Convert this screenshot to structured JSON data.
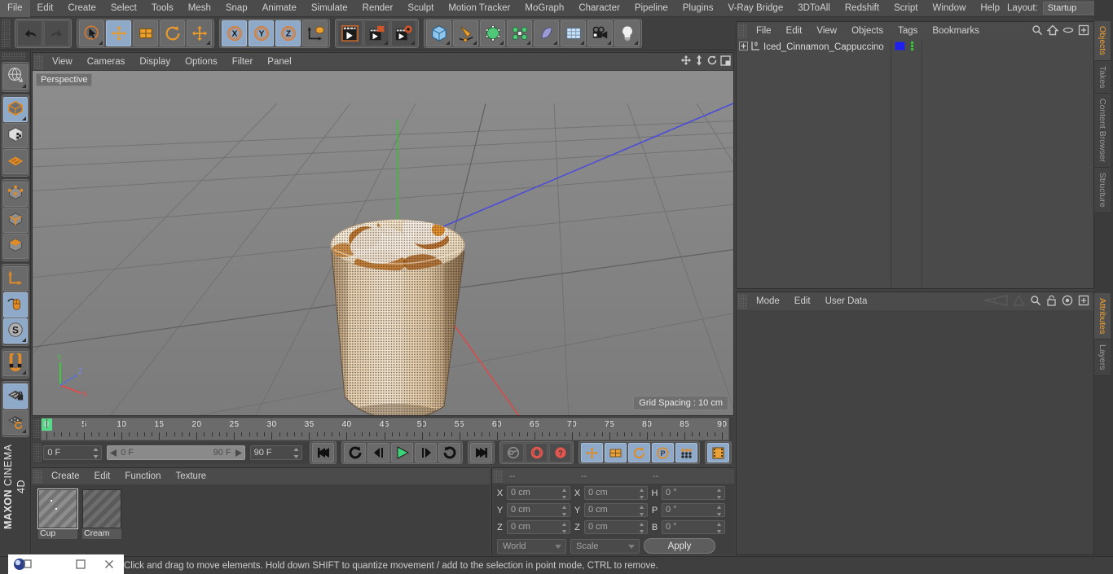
{
  "app": {
    "brand_line1": "MAXON",
    "brand_line2": "CINEMA 4D"
  },
  "menubar": {
    "items": [
      "File",
      "Edit",
      "Create",
      "Select",
      "Tools",
      "Mesh",
      "Snap",
      "Animate",
      "Simulate",
      "Render",
      "Sculpt",
      "Motion Tracker",
      "MoGraph",
      "Character",
      "Pipeline",
      "Plugins",
      "V-Ray Bridge",
      "3DToAll",
      "Redshift",
      "Script",
      "Window",
      "Help"
    ],
    "layout_label": "Layout:",
    "layout_value": "Startup",
    "search_icon": "search-icon"
  },
  "toolbar": {
    "groups": [
      {
        "name": "undo-redo",
        "buttons": [
          {
            "icon": "undo-icon",
            "label": "Undo",
            "active": false
          },
          {
            "icon": "redo-icon",
            "label": "Redo",
            "active": false
          }
        ]
      },
      {
        "name": "tools",
        "buttons": [
          {
            "icon": "live-selection-icon",
            "label": "Live Selection",
            "active": false
          },
          {
            "icon": "move-icon",
            "label": "Move",
            "active": true
          },
          {
            "icon": "scale-icon",
            "label": "Scale",
            "active": false
          },
          {
            "icon": "rotate-icon",
            "label": "Rotate",
            "active": false
          },
          {
            "icon": "move-alt-icon",
            "label": "Move Tool",
            "active": false
          }
        ]
      },
      {
        "name": "axis-locks",
        "buttons": [
          {
            "icon": "x-axis-icon",
            "label": "X",
            "active": true
          },
          {
            "icon": "y-axis-icon",
            "label": "Y",
            "active": true
          },
          {
            "icon": "z-axis-icon",
            "label": "Z",
            "active": true
          },
          {
            "icon": "world-object-axis-icon",
            "label": "World/Object",
            "active": false
          }
        ]
      },
      {
        "name": "render",
        "buttons": [
          {
            "icon": "render-view-icon",
            "label": "Render View",
            "active": false
          },
          {
            "icon": "render-region-icon",
            "label": "Render to Picture Viewer",
            "active": false
          },
          {
            "icon": "render-settings-icon",
            "label": "Render Settings",
            "active": false
          }
        ]
      },
      {
        "name": "creation",
        "buttons": [
          {
            "icon": "cube-primitive-icon",
            "label": "Cube",
            "active": false
          },
          {
            "icon": "spline-pen-icon",
            "label": "Pen",
            "active": false
          },
          {
            "icon": "generator-icon",
            "label": "Subdivision Surface",
            "active": false
          },
          {
            "icon": "deformer-icon",
            "label": "Bend Deformer",
            "active": false
          },
          {
            "icon": "scene-object-icon",
            "label": "Floor",
            "active": false
          },
          {
            "icon": "environment-icon",
            "label": "Environment",
            "active": false
          },
          {
            "icon": "camera-icon",
            "label": "Camera",
            "active": false
          },
          {
            "icon": "light-icon",
            "label": "Light",
            "active": false
          }
        ]
      }
    ]
  },
  "left_toolbar": {
    "groups": [
      {
        "name": "deform-group",
        "buttons": [
          {
            "icon": "make-editable-icon",
            "label": "Make Editable",
            "active": false
          }
        ]
      },
      {
        "name": "mode-group",
        "buttons": [
          {
            "icon": "model-mode-icon",
            "label": "Model Mode",
            "active": true
          },
          {
            "icon": "texture-mode-icon",
            "label": "Texture Mode",
            "active": false
          },
          {
            "icon": "workplane-mode-icon",
            "label": "Workplane Mode",
            "active": false
          }
        ]
      },
      {
        "name": "component-group",
        "buttons": [
          {
            "icon": "points-mode-icon",
            "label": "Points",
            "active": false
          },
          {
            "icon": "edges-mode-icon",
            "label": "Edges",
            "active": false
          },
          {
            "icon": "polygons-mode-icon",
            "label": "Polygons",
            "active": false
          }
        ]
      },
      {
        "name": "axis-group",
        "buttons": [
          {
            "icon": "enable-axis-icon",
            "label": "Enable Axis Modification",
            "active": false
          },
          {
            "icon": "viewport-solo-icon",
            "label": "Viewport Solo",
            "active": true
          },
          {
            "icon": "enable-snap-icon",
            "label": "Enable Snapping",
            "active": true
          }
        ]
      },
      {
        "name": "magnet-group",
        "buttons": [
          {
            "icon": "magnet-icon",
            "label": "Magnet",
            "active": false
          }
        ]
      },
      {
        "name": "workplane-group",
        "buttons": [
          {
            "icon": "lock-workplane-icon",
            "label": "Lock Workplane",
            "active": true
          },
          {
            "icon": "planar-workplane-icon",
            "label": "Planar Workplane",
            "active": false
          }
        ]
      }
    ]
  },
  "viewport": {
    "menu": [
      "View",
      "Cameras",
      "Display",
      "Options",
      "Filter",
      "Panel"
    ],
    "icons": [
      "pan-icon",
      "dolly-icon",
      "rotate-view-icon",
      "maximize-view-icon"
    ],
    "perspective_label": "Perspective",
    "grid_spacing_label": "Grid Spacing : 10 cm",
    "axis_gizmo": {
      "x": "X",
      "y": "Y",
      "z": "Z",
      "x_color": "#e04f4f",
      "y_color": "#4fc04f",
      "z_color": "#4f6fe0"
    },
    "scene_object_name": "Iced Cinnamon Cappuccino",
    "background_color": "#878787"
  },
  "timeline": {
    "ticks": [
      0,
      5,
      10,
      15,
      20,
      25,
      30,
      35,
      40,
      45,
      50,
      55,
      60,
      65,
      70,
      75,
      80,
      85,
      90
    ],
    "current_frame_marker": 0,
    "fields": {
      "current_frame": "0 F",
      "range_start": "0 F",
      "range_end": "90 F",
      "preview_max": "90 F",
      "end_frame": "0 F"
    },
    "transport": [
      {
        "icon": "go-to-start-icon",
        "label": "Go to Start",
        "active": false
      },
      {
        "icon": "play-backwards-loop-icon",
        "label": "Play Backwards",
        "active": false
      },
      {
        "icon": "step-back-icon",
        "label": "Previous Frame",
        "active": false
      },
      {
        "icon": "play-icon",
        "label": "Play",
        "active": false
      },
      {
        "icon": "step-forward-icon",
        "label": "Next Frame",
        "active": false
      },
      {
        "icon": "loop-icon",
        "label": "Loop",
        "active": false
      },
      {
        "icon": "go-to-end-icon",
        "label": "Go to End",
        "active": false
      }
    ],
    "keyframe_buttons": [
      {
        "icon": "record-key-icon",
        "label": "Record Active Objects",
        "active": false
      },
      {
        "icon": "autokeying-icon",
        "label": "Autokeying",
        "active": false
      },
      {
        "icon": "keyframe-selection-icon",
        "label": "Keyframe Selection",
        "active": false
      }
    ],
    "key_channels": [
      {
        "icon": "position-key-icon",
        "label": "Position",
        "active": true
      },
      {
        "icon": "scale-key-icon",
        "label": "Scale",
        "active": true
      },
      {
        "icon": "rotation-key-icon",
        "label": "Rotation",
        "active": true
      },
      {
        "icon": "parameter-key-icon",
        "label": "Parameter",
        "active": true
      },
      {
        "icon": "pla-key-icon",
        "label": "Point Level Animation",
        "active": true
      }
    ],
    "timeline_toggle": {
      "icon": "timeline-icon",
      "label": "Timeline",
      "active": true
    }
  },
  "material_manager": {
    "menu": [
      "Create",
      "Edit",
      "Function",
      "Texture"
    ],
    "materials": [
      {
        "name": "Cup",
        "selected": true
      },
      {
        "name": "Cream",
        "selected": false
      }
    ]
  },
  "coordinates": {
    "header": [
      "--",
      "--",
      "--"
    ],
    "rows": [
      {
        "labels": [
          "X",
          "X",
          "H"
        ],
        "values": [
          "0 cm",
          "0 cm",
          "0 °"
        ]
      },
      {
        "labels": [
          "Y",
          "Y",
          "P"
        ],
        "values": [
          "0 cm",
          "0 cm",
          "0 °"
        ]
      },
      {
        "labels": [
          "Z",
          "Z",
          "B"
        ],
        "values": [
          "0 cm",
          "0 cm",
          "0 °"
        ]
      }
    ],
    "coord_system": "World",
    "size_mode": "Scale",
    "apply_label": "Apply"
  },
  "object_manager": {
    "menu": [
      "File",
      "Edit",
      "View",
      "Objects",
      "Tags",
      "Bookmarks"
    ],
    "icons": [
      "search-icon",
      "home-icon",
      "ellipse-icon",
      "expand-icon"
    ],
    "object": {
      "name": "Iced_Cinnamon_Cappuccino",
      "layer_tag": "0",
      "tag_color": "#2020ee",
      "dots_color": "#37c837"
    }
  },
  "attribute_manager": {
    "menu": [
      "Mode",
      "Edit",
      "User Data"
    ],
    "icons": [
      "history-back-icon",
      "history-forward-icon",
      "search-icon",
      "lock-icon",
      "target-icon",
      "expand-icon"
    ]
  },
  "right_tabs": {
    "top": [
      {
        "label": "Objects",
        "active": true
      },
      {
        "label": "Takes",
        "active": false
      },
      {
        "label": "Content Browser",
        "active": false
      },
      {
        "label": "Structure",
        "active": false
      }
    ],
    "bottom": [
      {
        "label": "Attributes",
        "active": true
      },
      {
        "label": "Layers",
        "active": false
      }
    ]
  },
  "statusbar": {
    "text": "Click and drag to move elements. Hold down SHIFT to quantize movement / add to the selection in point mode, CTRL to remove."
  },
  "window_overlay": {
    "buttons": [
      "app-icon",
      "minimize-icon",
      "maximize-icon",
      "close-icon"
    ]
  }
}
